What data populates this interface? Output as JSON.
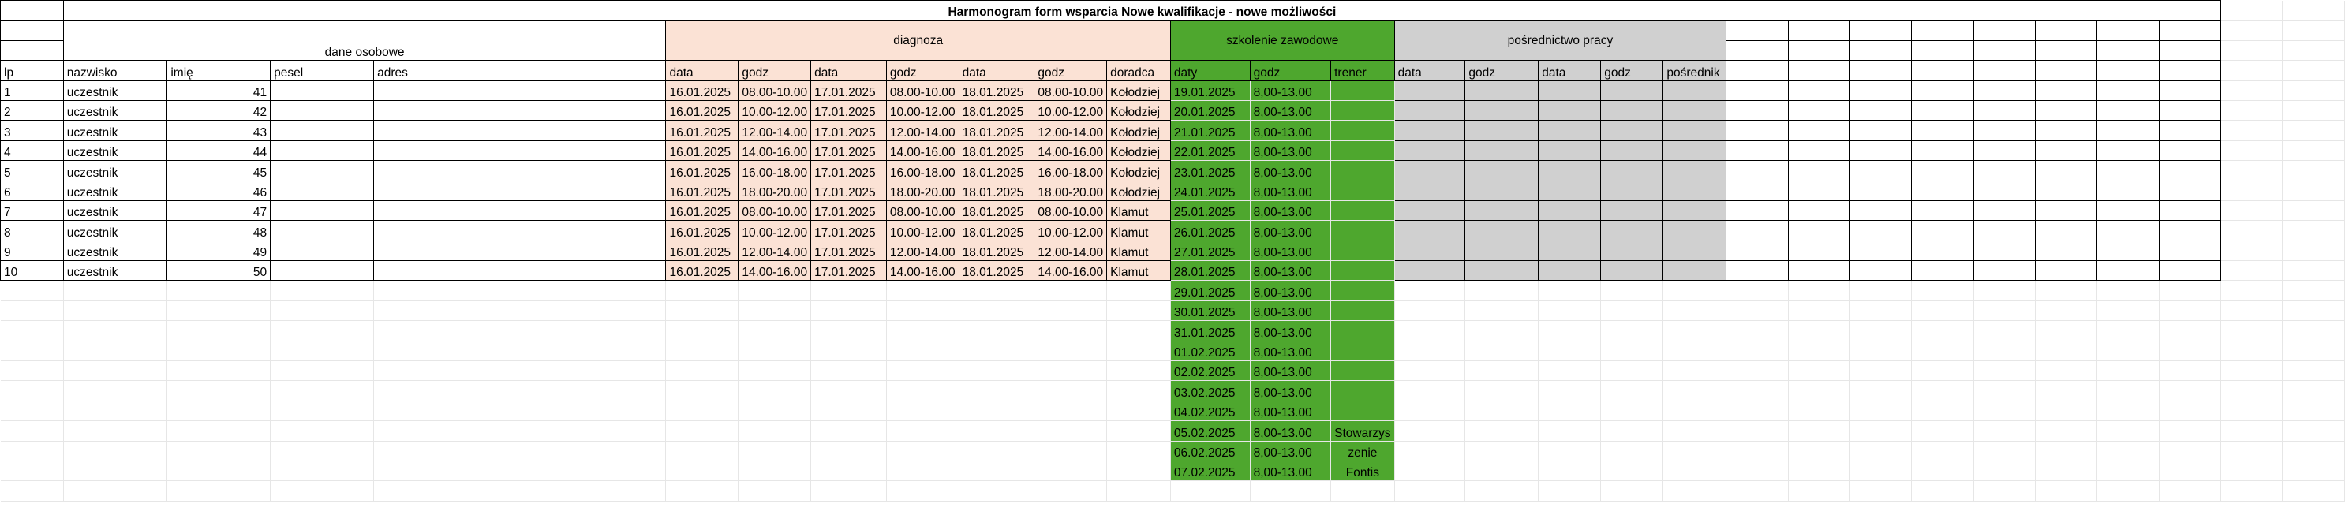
{
  "sheet": {
    "title": "Harmonogram form wsparcia Nowe kwalifikacje - nowe możliwości",
    "groups": {
      "dane_osobowe": "dane osobowe",
      "diagnoza": "diagnoza",
      "szkolenie": "szkolenie zawodowe",
      "posrednictwo": "pośrednictwo pracy"
    },
    "headers": {
      "lp": "lp",
      "nazwisko": "nazwisko",
      "imie": "imię",
      "pesel": "pesel",
      "adres": "adres",
      "data": "data",
      "godz": "godz",
      "doradca": "doradca",
      "daty": "daty",
      "trener": "trener",
      "posrednik": "pośrednik"
    },
    "rows": [
      {
        "lp": "1",
        "nazwisko": "uczestnik",
        "imie": "41",
        "d1": "16.01.2025",
        "g1": "08.00-10.00",
        "d2": "17.01.2025",
        "g2": "08.00-10.00",
        "d3": "18.01.2025",
        "g3": "08.00-10.00",
        "doradca": "Kołodziej"
      },
      {
        "lp": "2",
        "nazwisko": "uczestnik",
        "imie": "42",
        "d1": "16.01.2025",
        "g1": "10.00-12.00",
        "d2": "17.01.2025",
        "g2": "10.00-12.00",
        "d3": "18.01.2025",
        "g3": "10.00-12.00",
        "doradca": "Kołodziej"
      },
      {
        "lp": "3",
        "nazwisko": "uczestnik",
        "imie": "43",
        "d1": "16.01.2025",
        "g1": "12.00-14.00",
        "d2": "17.01.2025",
        "g2": "12.00-14.00",
        "d3": "18.01.2025",
        "g3": "12.00-14.00",
        "doradca": "Kołodziej"
      },
      {
        "lp": "4",
        "nazwisko": "uczestnik",
        "imie": "44",
        "d1": "16.01.2025",
        "g1": "14.00-16.00",
        "d2": "17.01.2025",
        "g2": "14.00-16.00",
        "d3": "18.01.2025",
        "g3": "14.00-16.00",
        "doradca": "Kołodziej"
      },
      {
        "lp": "5",
        "nazwisko": "uczestnik",
        "imie": "45",
        "d1": "16.01.2025",
        "g1": "16.00-18.00",
        "d2": "17.01.2025",
        "g2": "16.00-18.00",
        "d3": "18.01.2025",
        "g3": "16.00-18.00",
        "doradca": "Kołodziej"
      },
      {
        "lp": "6",
        "nazwisko": "uczestnik",
        "imie": "46",
        "d1": "16.01.2025",
        "g1": "18.00-20.00",
        "d2": "17.01.2025",
        "g2": "18.00-20.00",
        "d3": "18.01.2025",
        "g3": "18.00-20.00",
        "doradca": "Kołodziej"
      },
      {
        "lp": "7",
        "nazwisko": "uczestnik",
        "imie": "47",
        "d1": "16.01.2025",
        "g1": "08.00-10.00",
        "d2": "17.01.2025",
        "g2": "08.00-10.00",
        "d3": "18.01.2025",
        "g3": "08.00-10.00",
        "doradca": "Klamut"
      },
      {
        "lp": "8",
        "nazwisko": "uczestnik",
        "imie": "48",
        "d1": "16.01.2025",
        "g1": "10.00-12.00",
        "d2": "17.01.2025",
        "g2": "10.00-12.00",
        "d3": "18.01.2025",
        "g3": "10.00-12.00",
        "doradca": "Klamut"
      },
      {
        "lp": "9",
        "nazwisko": "uczestnik",
        "imie": "49",
        "d1": "16.01.2025",
        "g1": "12.00-14.00",
        "d2": "17.01.2025",
        "g2": "12.00-14.00",
        "d3": "18.01.2025",
        "g3": "12.00-14.00",
        "doradca": "Klamut"
      },
      {
        "lp": "10",
        "nazwisko": "uczestnik",
        "imie": "50",
        "d1": "16.01.2025",
        "g1": "14.00-16.00",
        "d2": "17.01.2025",
        "g2": "14.00-16.00",
        "d3": "18.01.2025",
        "g3": "14.00-16.00",
        "doradca": "Klamut"
      }
    ],
    "training": [
      {
        "date": "19.01.2025",
        "hours": "8,00-13.00",
        "trener": ""
      },
      {
        "date": "20.01.2025",
        "hours": "8,00-13.00",
        "trener": ""
      },
      {
        "date": "21.01.2025",
        "hours": "8,00-13.00",
        "trener": ""
      },
      {
        "date": "22.01.2025",
        "hours": "8,00-13.00",
        "trener": ""
      },
      {
        "date": "23.01.2025",
        "hours": "8,00-13.00",
        "trener": ""
      },
      {
        "date": "24.01.2025",
        "hours": "8,00-13.00",
        "trener": ""
      },
      {
        "date": "25.01.2025",
        "hours": "8,00-13.00",
        "trener": ""
      },
      {
        "date": "26.01.2025",
        "hours": "8,00-13.00",
        "trener": ""
      },
      {
        "date": "27.01.2025",
        "hours": "8,00-13.00",
        "trener": ""
      },
      {
        "date": "28.01.2025",
        "hours": "8,00-13.00",
        "trener": ""
      },
      {
        "date": "29.01.2025",
        "hours": "8,00-13.00",
        "trener": ""
      },
      {
        "date": "30.01.2025",
        "hours": "8,00-13.00",
        "trener": ""
      },
      {
        "date": "31.01.2025",
        "hours": "8,00-13.00",
        "trener": ""
      },
      {
        "date": "01.02.2025",
        "hours": "8,00-13.00",
        "trener": ""
      },
      {
        "date": "02.02.2025",
        "hours": "8,00-13.00",
        "trener": ""
      },
      {
        "date": "03.02.2025",
        "hours": "8,00-13.00",
        "trener": ""
      },
      {
        "date": "04.02.2025",
        "hours": "8,00-13.00",
        "trener": ""
      },
      {
        "date": "05.02.2025",
        "hours": "8,00-13.00",
        "trener": "Stowarzys"
      },
      {
        "date": "06.02.2025",
        "hours": "8,00-13.00",
        "trener": "zenie"
      },
      {
        "date": "07.02.2025",
        "hours": "8,00-13.00",
        "trener": "Fontis"
      }
    ],
    "colors": {
      "peach": "#fbe2d5",
      "green": "#4ea72e",
      "grey": "#d0d0d0"
    }
  }
}
